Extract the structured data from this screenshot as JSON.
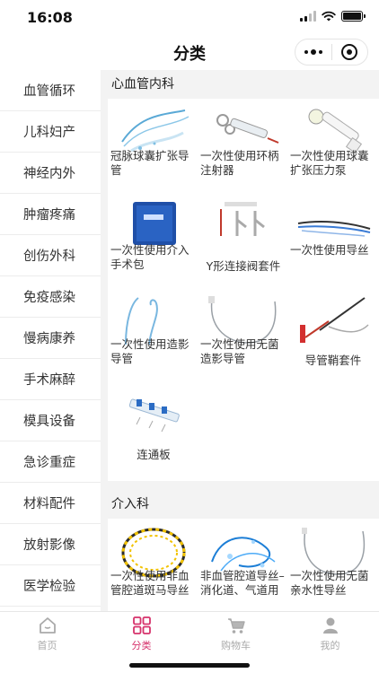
{
  "status": {
    "time": "16:08"
  },
  "nav": {
    "title": "分类"
  },
  "sidebar": {
    "items": [
      {
        "label": "血管循环"
      },
      {
        "label": "儿科妇产"
      },
      {
        "label": "神经内外"
      },
      {
        "label": "肿瘤疼痛"
      },
      {
        "label": "创伤外科"
      },
      {
        "label": "免疫感染"
      },
      {
        "label": "慢病康养"
      },
      {
        "label": "手术麻醉"
      },
      {
        "label": "模具设备"
      },
      {
        "label": "急诊重症"
      },
      {
        "label": "材料配件"
      },
      {
        "label": "放射影像"
      },
      {
        "label": "医学检验"
      }
    ]
  },
  "sections": [
    {
      "title": "心血管内科",
      "products": [
        {
          "label": "冠脉球囊扩张导管"
        },
        {
          "label": "一次性使用环柄注射器"
        },
        {
          "label": "一次性使用球囊扩张压力泵"
        },
        {
          "label": "一次性使用介入手术包"
        },
        {
          "label": "Y形连接阀套件"
        },
        {
          "label": "一次性使用导丝"
        },
        {
          "label": "一次性使用造影导管"
        },
        {
          "label": "一次性使用无菌造影导管"
        },
        {
          "label": "导管鞘套件"
        },
        {
          "label": "连通板"
        }
      ]
    },
    {
      "title": "介入科",
      "products": [
        {
          "label": "一次性使用非血管腔道斑马导丝"
        },
        {
          "label": "非血管腔道导丝–消化道、气道用"
        },
        {
          "label": "一次性使用无菌亲水性导丝"
        }
      ]
    }
  ],
  "tabbar": {
    "items": [
      {
        "label": "首页",
        "icon": "home-icon"
      },
      {
        "label": "分类",
        "icon": "category-grid-icon"
      },
      {
        "label": "购物车",
        "icon": "cart-icon"
      },
      {
        "label": "我的",
        "icon": "user-icon"
      }
    ],
    "active_color": "#d6336c",
    "inactive_color": "#aaaaaa"
  }
}
